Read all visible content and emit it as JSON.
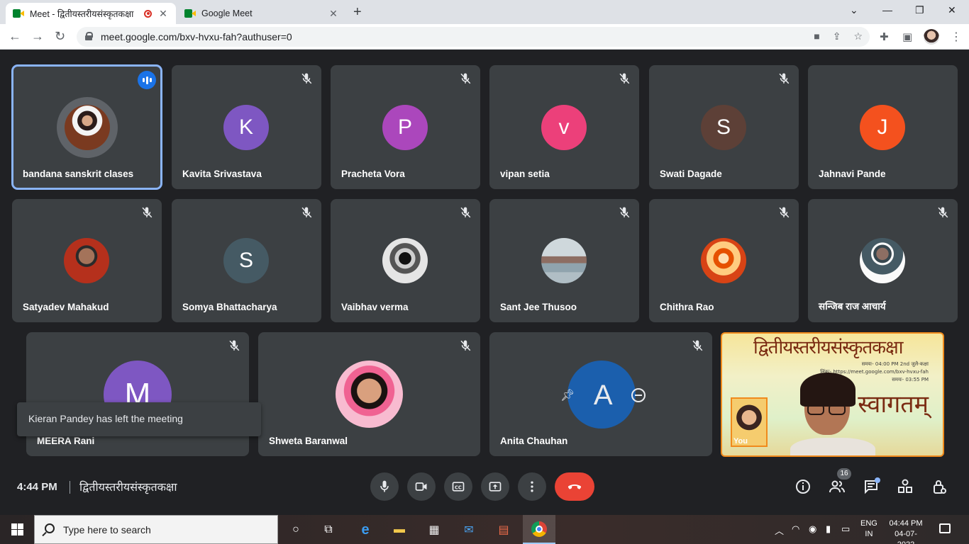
{
  "browser": {
    "tabs": [
      {
        "title": "Meet - द्वितीयस्तरीयसंस्कृतकक्षा",
        "active": true,
        "recording": true
      },
      {
        "title": "Google Meet",
        "active": false
      }
    ],
    "url": "meet.google.com/bxv-hvxu-fah?authuser=0"
  },
  "participants": [
    {
      "name": "bandana sanskrit clases",
      "avatar_type": "photo",
      "speaking": true
    },
    {
      "name": "Kavita Srivastava",
      "initial": "K",
      "color": "#7e57c2",
      "muted": true
    },
    {
      "name": "Pracheta Vora",
      "initial": "P",
      "color": "#ab47bc",
      "muted": true
    },
    {
      "name": "vipan setia",
      "initial": "v",
      "color": "#ec407a",
      "muted": true
    },
    {
      "name": "Swati Dagade",
      "initial": "S",
      "color": "#5d4037",
      "muted": true
    },
    {
      "name": "Jahnavi Pande",
      "initial": "J",
      "color": "#f4511e",
      "muted": true
    },
    {
      "name": "Satyadev Mahakud",
      "avatar_type": "photo",
      "muted": true
    },
    {
      "name": "Somya Bhattacharya",
      "initial": "S",
      "color": "#455a64",
      "muted": true
    },
    {
      "name": "Vaibhav verma",
      "avatar_type": "photo",
      "muted": true
    },
    {
      "name": "Sant Jee Thusoo",
      "avatar_type": "photo",
      "muted": true
    },
    {
      "name": "Chithra Rao",
      "avatar_type": "photo",
      "muted": true
    },
    {
      "name": "सन्जिब राज आचार्य",
      "avatar_type": "photo",
      "muted": true
    },
    {
      "name": "MEERA Rani",
      "initial": "M",
      "color": "#7e57c2",
      "muted": true
    },
    {
      "name": "Shweta Baranwal",
      "avatar_type": "photo",
      "muted": true
    },
    {
      "name": "Anita Chauhan",
      "initial": "A",
      "color": "#1565c0",
      "muted": true
    }
  ],
  "self_tile": {
    "label": "You",
    "banner_text": "द्वितीयस्तरीयसंस्कृतकक्षा",
    "info_lines": [
      "समयः- 04:00 PM 2nd जुलै-कक्षा",
      "लिंकः- https://meet.google.com/bxv-hvxu-fah",
      "समयः- 03:55 PM"
    ],
    "big_text": "स्वागतम्"
  },
  "toast": "Kieran Pandey has left the meeting",
  "controls": {
    "time": "4:44 PM",
    "meeting_title": "द्वितीयस्तरीयसंस्कृतकक्षा",
    "people_count": "16"
  },
  "taskbar": {
    "search_placeholder": "Type here to search",
    "lang_top": "ENG",
    "lang_bottom": "IN",
    "time": "04:44 PM",
    "date": "04-07-2022"
  }
}
